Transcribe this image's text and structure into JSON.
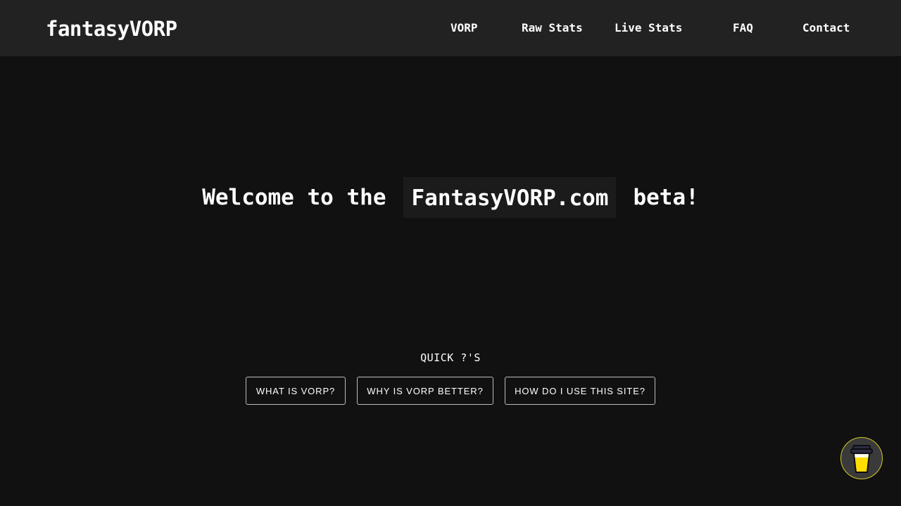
{
  "header": {
    "brand": "fantasyVORP",
    "nav": [
      {
        "label": "VORP"
      },
      {
        "label": "Raw Stats"
      },
      {
        "label": "Live Stats"
      },
      {
        "label": "FAQ"
      },
      {
        "label": "Contact"
      }
    ]
  },
  "hero": {
    "prefix": "Welcome to the",
    "site_name": "FantasyVORP.com",
    "suffix": "beta!"
  },
  "quick_questions": {
    "title": "QUICK ?'S",
    "buttons": [
      {
        "label": "WHAT IS VORP?"
      },
      {
        "label": "WHY IS VORP BETTER?"
      },
      {
        "label": "HOW DO I USE THIS SITE?"
      }
    ]
  },
  "floating_button": {
    "icon": "coffee-cup-icon"
  },
  "colors": {
    "background": "#111111",
    "navbar": "#222222",
    "highlight": "#1b1b1b",
    "coffee_accent": "#ffdd00",
    "coffee_border": "#d6c928"
  }
}
